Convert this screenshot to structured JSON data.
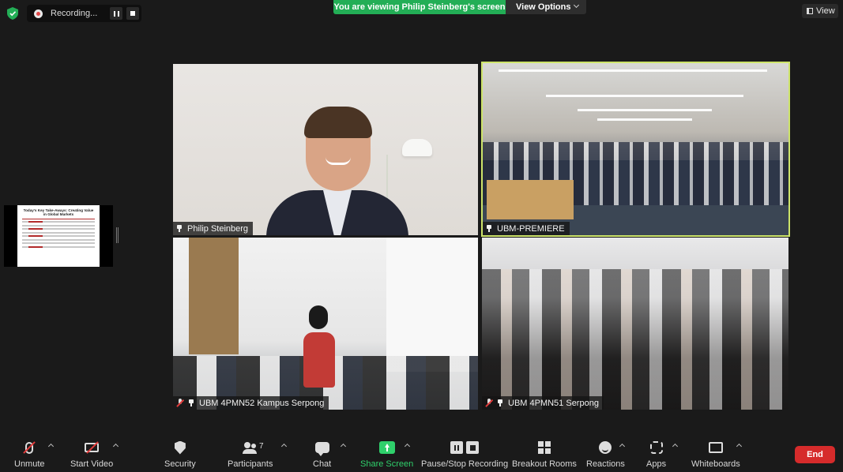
{
  "top_bar": {
    "recording_label": "Recording...",
    "viewing_banner": "You are viewing Philip Steinberg's screen",
    "view_options_label": "View Options",
    "view_label": "View"
  },
  "shared_slide": {
    "title": "Today's Key Take-Aways: Creating Value in Global Markets"
  },
  "tiles": [
    {
      "name": "Philip Steinberg",
      "pinned": true,
      "muted": false
    },
    {
      "name": "UBM-PREMIERE",
      "pinned": true,
      "muted": false,
      "active_speaker": true
    },
    {
      "name": "UBM 4PMN52 Kampus Serpong",
      "pinned": true,
      "muted": true
    },
    {
      "name": "UBM 4PMN51 Serpong",
      "pinned": true,
      "muted": true
    }
  ],
  "toolbar": {
    "unmute": "Unmute",
    "start_video": "Start Video",
    "security": "Security",
    "participants": "Participants",
    "participants_count": "7",
    "chat": "Chat",
    "share_screen": "Share Screen",
    "pause_stop_recording": "Pause/Stop Recording",
    "breakout_rooms": "Breakout Rooms",
    "reactions": "Reactions",
    "apps": "Apps",
    "whiteboards": "Whiteboards",
    "end": "End"
  },
  "colors": {
    "accent_green": "#23ae56",
    "end_red": "#d62b2b",
    "speaker_highlight": "#cde46a"
  }
}
